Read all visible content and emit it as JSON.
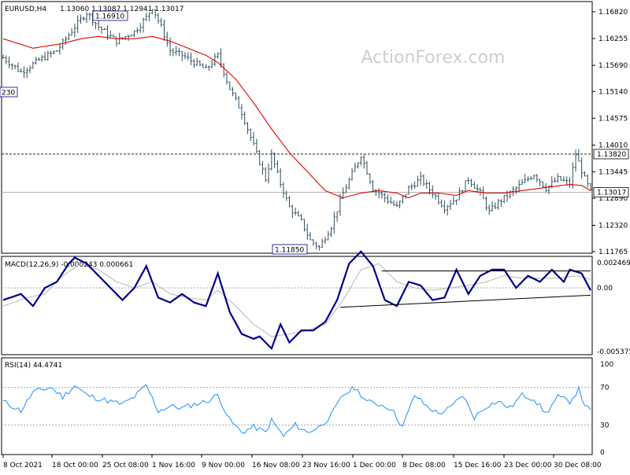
{
  "chart_data": {
    "type": "candlestick",
    "instrument": "EURUSD,H4",
    "ohlc_label": "1.13060 1.13087 1.12941 1.13017",
    "watermark": "ActionForex.com",
    "colors": {
      "bars": "#2f4f5f",
      "ma": "#e60000",
      "macd": "#00008b",
      "signal": "#b8b8b8",
      "rsi": "#1e90ff",
      "trend": "#000000",
      "bg": "#ffffff"
    },
    "price_axis": {
      "range": [
        1.11765,
        1.17
      ],
      "ticks": [
        "1.16820",
        "1.16255",
        "1.15690",
        "1.15140",
        "1.14575",
        "1.14010",
        "1.13445",
        "1.12890",
        "1.12320",
        "1.11765"
      ]
    },
    "levels": {
      "resistance": "1.13820",
      "last": "1.13017"
    },
    "annotations": {
      "high": "1.16910",
      "low": "1.11850",
      "left_cut": "230"
    },
    "x_labels": [
      "8 Oct 2021",
      "18 Oct 00:00",
      "25 Oct 08:00",
      "1 Nov 16:00",
      "9 Nov 00:00",
      "16 Nov 08:00",
      "23 Nov 16:00",
      "1 Dec 00:00",
      "8 Dec 08:00",
      "15 Dec 16:00",
      "23 Dec 00:00",
      "30 Dec 08:00"
    ],
    "price_path": [
      [
        0,
        1.1585
      ],
      [
        6,
        1.1555
      ],
      [
        12,
        1.158
      ],
      [
        18,
        1.16
      ],
      [
        24,
        1.165
      ],
      [
        28,
        1.168
      ],
      [
        32,
        1.165
      ],
      [
        38,
        1.162
      ],
      [
        44,
        1.164
      ],
      [
        48,
        1.167
      ],
      [
        50,
        1.1691
      ],
      [
        53,
        1.165
      ],
      [
        56,
        1.16
      ],
      [
        60,
        1.159
      ],
      [
        64,
        1.1575
      ],
      [
        68,
        1.156
      ],
      [
        72,
        1.159
      ],
      [
        76,
        1.152
      ],
      [
        80,
        1.147
      ],
      [
        84,
        1.14
      ],
      [
        88,
        1.133
      ],
      [
        90,
        1.138
      ],
      [
        93,
        1.132
      ],
      [
        96,
        1.127
      ],
      [
        100,
        1.124
      ],
      [
        103,
        1.12
      ],
      [
        106,
        1.1185
      ],
      [
        110,
        1.123
      ],
      [
        114,
        1.13
      ],
      [
        117,
        1.134
      ],
      [
        120,
        1.138
      ],
      [
        124,
        1.131
      ],
      [
        128,
        1.129
      ],
      [
        132,
        1.127
      ],
      [
        136,
        1.131
      ],
      [
        140,
        1.133
      ],
      [
        144,
        1.13
      ],
      [
        148,
        1.127
      ],
      [
        152,
        1.129
      ],
      [
        156,
        1.133
      ],
      [
        160,
        1.13
      ],
      [
        163,
        1.126
      ],
      [
        166,
        1.128
      ],
      [
        170,
        1.13
      ],
      [
        174,
        1.132
      ],
      [
        178,
        1.134
      ],
      [
        182,
        1.131
      ],
      [
        186,
        1.133
      ],
      [
        190,
        1.132
      ],
      [
        192,
        1.1382
      ],
      [
        195,
        1.133
      ],
      [
        197,
        1.1302
      ]
    ],
    "ma_path": [
      [
        0,
        1.1625
      ],
      [
        10,
        1.1605
      ],
      [
        20,
        1.1615
      ],
      [
        26,
        1.1625
      ],
      [
        32,
        1.163
      ],
      [
        38,
        1.1625
      ],
      [
        44,
        1.1625
      ],
      [
        50,
        1.163
      ],
      [
        56,
        1.162
      ],
      [
        62,
        1.1605
      ],
      [
        68,
        1.159
      ],
      [
        72,
        1.1575
      ],
      [
        78,
        1.154
      ],
      [
        84,
        1.149
      ],
      [
        90,
        1.1435
      ],
      [
        96,
        1.1385
      ],
      [
        102,
        1.1345
      ],
      [
        108,
        1.1305
      ],
      [
        114,
        1.129
      ],
      [
        120,
        1.13
      ],
      [
        126,
        1.1305
      ],
      [
        132,
        1.13
      ],
      [
        136,
        1.129
      ],
      [
        140,
        1.13
      ],
      [
        146,
        1.13
      ],
      [
        152,
        1.1295
      ],
      [
        156,
        1.1305
      ],
      [
        162,
        1.13
      ],
      [
        168,
        1.13
      ],
      [
        174,
        1.1305
      ],
      [
        180,
        1.131
      ],
      [
        186,
        1.1315
      ],
      [
        190,
        1.1318
      ],
      [
        194,
        1.1316
      ],
      [
        197,
        1.1305
      ]
    ],
    "macd_label": "MACD(12,26,9) -0.000243 0.000661",
    "macd_axis": {
      "range": [
        -0.005375,
        0.002469
      ],
      "ticks": [
        "0.002469",
        "0.00",
        "-0.005375"
      ]
    },
    "macd_path": [
      [
        0,
        -0.001
      ],
      [
        6,
        -0.0005
      ],
      [
        10,
        -0.0015
      ],
      [
        14,
        0.0
      ],
      [
        18,
        0.0005
      ],
      [
        22,
        0.002
      ],
      [
        24,
        0.0025
      ],
      [
        28,
        0.002
      ],
      [
        32,
        0.001
      ],
      [
        36,
        0.0
      ],
      [
        40,
        -0.001
      ],
      [
        44,
        0.0
      ],
      [
        48,
        0.0018
      ],
      [
        52,
        -0.0008
      ],
      [
        56,
        -0.0012
      ],
      [
        60,
        -0.0005
      ],
      [
        64,
        -0.0012
      ],
      [
        68,
        -0.0015
      ],
      [
        72,
        0.0012
      ],
      [
        76,
        -0.002
      ],
      [
        80,
        -0.0038
      ],
      [
        84,
        -0.0042
      ],
      [
        86,
        -0.004
      ],
      [
        90,
        -0.005
      ],
      [
        93,
        -0.003
      ],
      [
        96,
        -0.0045
      ],
      [
        100,
        -0.0035
      ],
      [
        104,
        -0.0035
      ],
      [
        108,
        -0.0028
      ],
      [
        112,
        -0.001
      ],
      [
        116,
        0.002
      ],
      [
        120,
        0.003
      ],
      [
        124,
        0.0018
      ],
      [
        128,
        -0.001
      ],
      [
        132,
        -0.0015
      ],
      [
        136,
        0.0005
      ],
      [
        140,
        0.0002
      ],
      [
        144,
        -0.001
      ],
      [
        148,
        -0.0008
      ],
      [
        152,
        0.0015
      ],
      [
        156,
        -0.0005
      ],
      [
        160,
        0.001
      ],
      [
        164,
        0.0015
      ],
      [
        168,
        0.0015
      ],
      [
        172,
        0.0
      ],
      [
        176,
        0.001
      ],
      [
        180,
        0.0005
      ],
      [
        184,
        0.0015
      ],
      [
        188,
        0.0005
      ],
      [
        190,
        0.0015
      ],
      [
        194,
        0.0012
      ],
      [
        197,
        -0.0002
      ]
    ],
    "signal_path": [
      [
        0,
        -0.0015
      ],
      [
        8,
        -0.0008
      ],
      [
        14,
        -0.0005
      ],
      [
        20,
        0.001
      ],
      [
        26,
        0.002
      ],
      [
        32,
        0.0015
      ],
      [
        38,
        0.0005
      ],
      [
        44,
        0.0
      ],
      [
        50,
        0.0005
      ],
      [
        56,
        -0.0005
      ],
      [
        62,
        -0.0008
      ],
      [
        68,
        -0.001
      ],
      [
        72,
        -0.0002
      ],
      [
        78,
        -0.0015
      ],
      [
        84,
        -0.003
      ],
      [
        90,
        -0.004
      ],
      [
        96,
        -0.0038
      ],
      [
        102,
        -0.0035
      ],
      [
        108,
        -0.003
      ],
      [
        114,
        -0.001
      ],
      [
        120,
        0.0015
      ],
      [
        126,
        0.002
      ],
      [
        132,
        0.0005
      ],
      [
        138,
        0.0
      ],
      [
        144,
        -0.0002
      ],
      [
        150,
        0.0
      ],
      [
        156,
        0.0002
      ],
      [
        162,
        0.0005
      ],
      [
        168,
        0.001
      ],
      [
        174,
        0.0008
      ],
      [
        180,
        0.0008
      ],
      [
        186,
        0.0008
      ],
      [
        192,
        0.001
      ],
      [
        197,
        0.0007
      ]
    ],
    "trend_lines": [
      {
        "from": [
          127,
          0.0014
        ],
        "to": [
          197,
          0.0014
        ]
      },
      {
        "from": [
          113,
          -0.0016
        ],
        "to": [
          197,
          -0.0006
        ]
      }
    ],
    "rsi_label": "RSI(14) 44.4741",
    "rsi_axis": {
      "range": [
        0,
        100
      ],
      "ticks": [
        "100",
        "70",
        "30",
        "0"
      ]
    },
    "rsi_path": [
      [
        0,
        55
      ],
      [
        6,
        45
      ],
      [
        10,
        65
      ],
      [
        16,
        70
      ],
      [
        20,
        60
      ],
      [
        24,
        72
      ],
      [
        28,
        62
      ],
      [
        32,
        58
      ],
      [
        36,
        55
      ],
      [
        40,
        52
      ],
      [
        44,
        60
      ],
      [
        48,
        72
      ],
      [
        52,
        45
      ],
      [
        56,
        50
      ],
      [
        60,
        48
      ],
      [
        64,
        52
      ],
      [
        68,
        55
      ],
      [
        72,
        62
      ],
      [
        76,
        35
      ],
      [
        80,
        22
      ],
      [
        84,
        28
      ],
      [
        88,
        22
      ],
      [
        90,
        35
      ],
      [
        94,
        18
      ],
      [
        98,
        30
      ],
      [
        102,
        22
      ],
      [
        106,
        28
      ],
      [
        110,
        40
      ],
      [
        114,
        62
      ],
      [
        118,
        70
      ],
      [
        122,
        55
      ],
      [
        126,
        52
      ],
      [
        130,
        48
      ],
      [
        134,
        28
      ],
      [
        138,
        62
      ],
      [
        142,
        50
      ],
      [
        146,
        42
      ],
      [
        150,
        48
      ],
      [
        154,
        62
      ],
      [
        158,
        38
      ],
      [
        162,
        50
      ],
      [
        166,
        55
      ],
      [
        170,
        48
      ],
      [
        174,
        62
      ],
      [
        178,
        58
      ],
      [
        182,
        42
      ],
      [
        186,
        60
      ],
      [
        190,
        55
      ],
      [
        193,
        68
      ],
      [
        195,
        52
      ],
      [
        197,
        44
      ]
    ]
  }
}
